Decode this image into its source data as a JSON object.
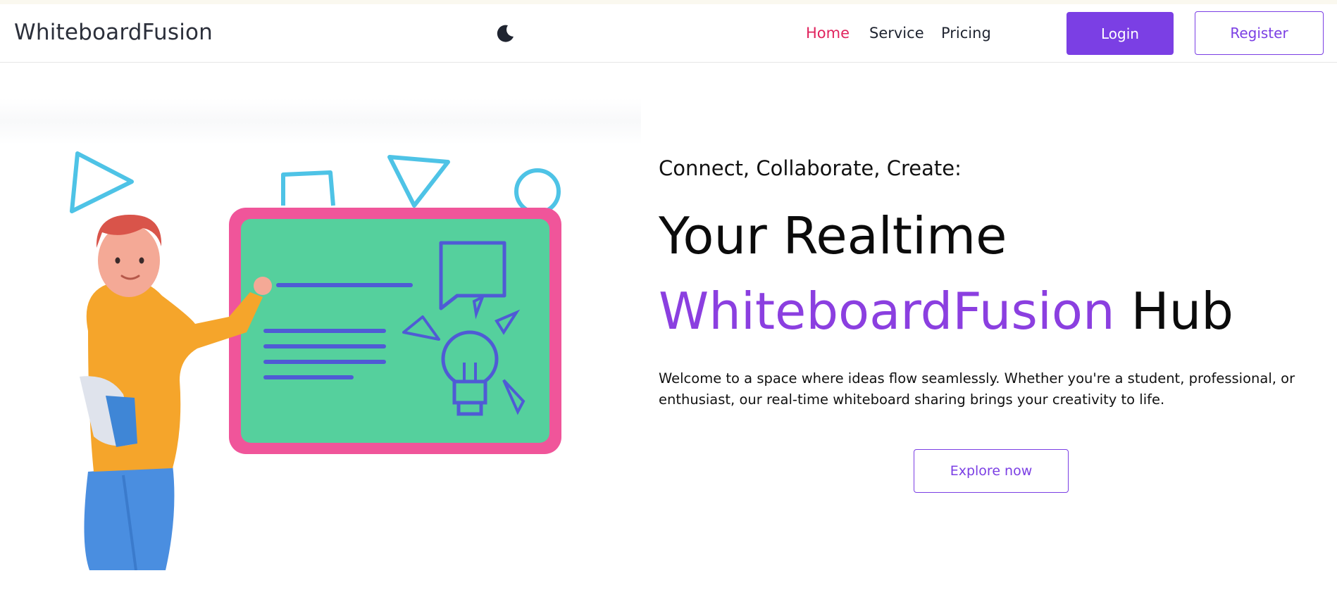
{
  "navbar": {
    "brand": "WhiteboardFusion",
    "theme_toggle_icon": "moon-icon",
    "links": [
      {
        "label": "Home",
        "active": true
      },
      {
        "label": "Service",
        "active": false
      },
      {
        "label": "Pricing",
        "active": false
      }
    ],
    "login_label": "Login",
    "register_label": "Register"
  },
  "hero": {
    "tagline": "Connect, Collaborate, Create:",
    "headline_line1": "Your Realtime",
    "headline_accent": "WhiteboardFusion",
    "headline_rest": " Hub",
    "description": "Welcome to a space where ideas flow seamlessly. Whether you're a student, professional, or enthusiast, our real-time whiteboard sharing brings your creativity to life.",
    "cta_label": "Explore now"
  },
  "illustration": {
    "icon": "teacher-at-whiteboard-illustration"
  },
  "colors": {
    "accent_purple": "#7b3fe4",
    "headline_purple": "#8b3fe0",
    "active_link": "#e0245e",
    "board_frame": "#f0559a",
    "board_surface": "#55d09d"
  }
}
